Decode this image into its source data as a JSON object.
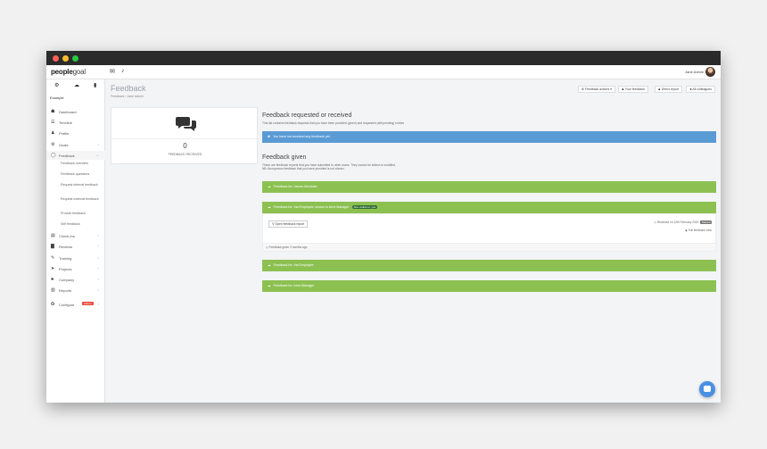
{
  "app": {
    "logo_bold": "people",
    "logo_light": "goal",
    "user_name": "Jane Admin"
  },
  "sidebar": {
    "company": "Example",
    "items": [
      {
        "label": "Dashboard",
        "icon": "dashboard-icon",
        "glyph": "☗"
      },
      {
        "label": "Timeline",
        "icon": "timeline-icon",
        "glyph": "☰"
      },
      {
        "label": "Profile",
        "icon": "profile-icon",
        "glyph": "♟"
      },
      {
        "label": "Goals",
        "icon": "goals-icon",
        "glyph": "⚙"
      },
      {
        "label": "Feedback",
        "icon": "feedback-icon",
        "glyph": "◯"
      },
      {
        "label": "Check-ins",
        "icon": "checkins-icon",
        "glyph": "▤"
      },
      {
        "label": "Reviews",
        "icon": "reviews-icon",
        "glyph": "▇"
      },
      {
        "label": "Training",
        "icon": "training-icon",
        "glyph": "✎"
      },
      {
        "label": "Projects",
        "icon": "projects-icon",
        "glyph": "➤"
      },
      {
        "label": "Company",
        "icon": "company-icon",
        "glyph": "♣"
      },
      {
        "label": "Reports",
        "icon": "reports-icon",
        "glyph": "▥"
      },
      {
        "label": "Configure",
        "icon": "configure-icon",
        "glyph": "✪",
        "badge": "Admin"
      }
    ],
    "feedback_sub": [
      "Feedback overview",
      "Feedback questions",
      "Request internal feedback",
      "Request external feedback",
      "Provide feedback",
      "Self feedback"
    ]
  },
  "header": {
    "title": "Feedback",
    "breadcrumb": "Feedback › Jane Admin",
    "actions": [
      "Feedback actions",
      "Your feedback",
      "Direct report",
      "All colleagues"
    ]
  },
  "stat": {
    "value": "0",
    "label": "FEEDBACK RECEIVED"
  },
  "received_section": {
    "title": "Feedback requested or received",
    "desc": "This list contains feedback requests that you have been provided (given) and requested (still pending) entries",
    "notice": "You have not received any feedback yet."
  },
  "given_section": {
    "title": "Feedback given",
    "desc1": "These are feedback reports that you have submitted to other users. They cannot be edited or modified.",
    "desc2": "NB: Anonymous feedback that you have provided is not shown.",
    "bars": [
      "Feedback for: James Mcintosh",
      "Feedback for: Ina Employee, shown to Arne Manager",
      "Feedback for: Ina Employee",
      "Feedback for: Arne Manager"
    ],
    "pill": "Also visible to: you",
    "open_report": "Open feedback report",
    "received_on": "Received on 12th February 2019",
    "received_tag": "Started",
    "full_link": "Full feedback view",
    "given_ago": "Feedback given 3 months ago"
  },
  "colors": {
    "green": "#8cc152",
    "blue": "#5b9bd5",
    "chat": "#4a90e2"
  }
}
